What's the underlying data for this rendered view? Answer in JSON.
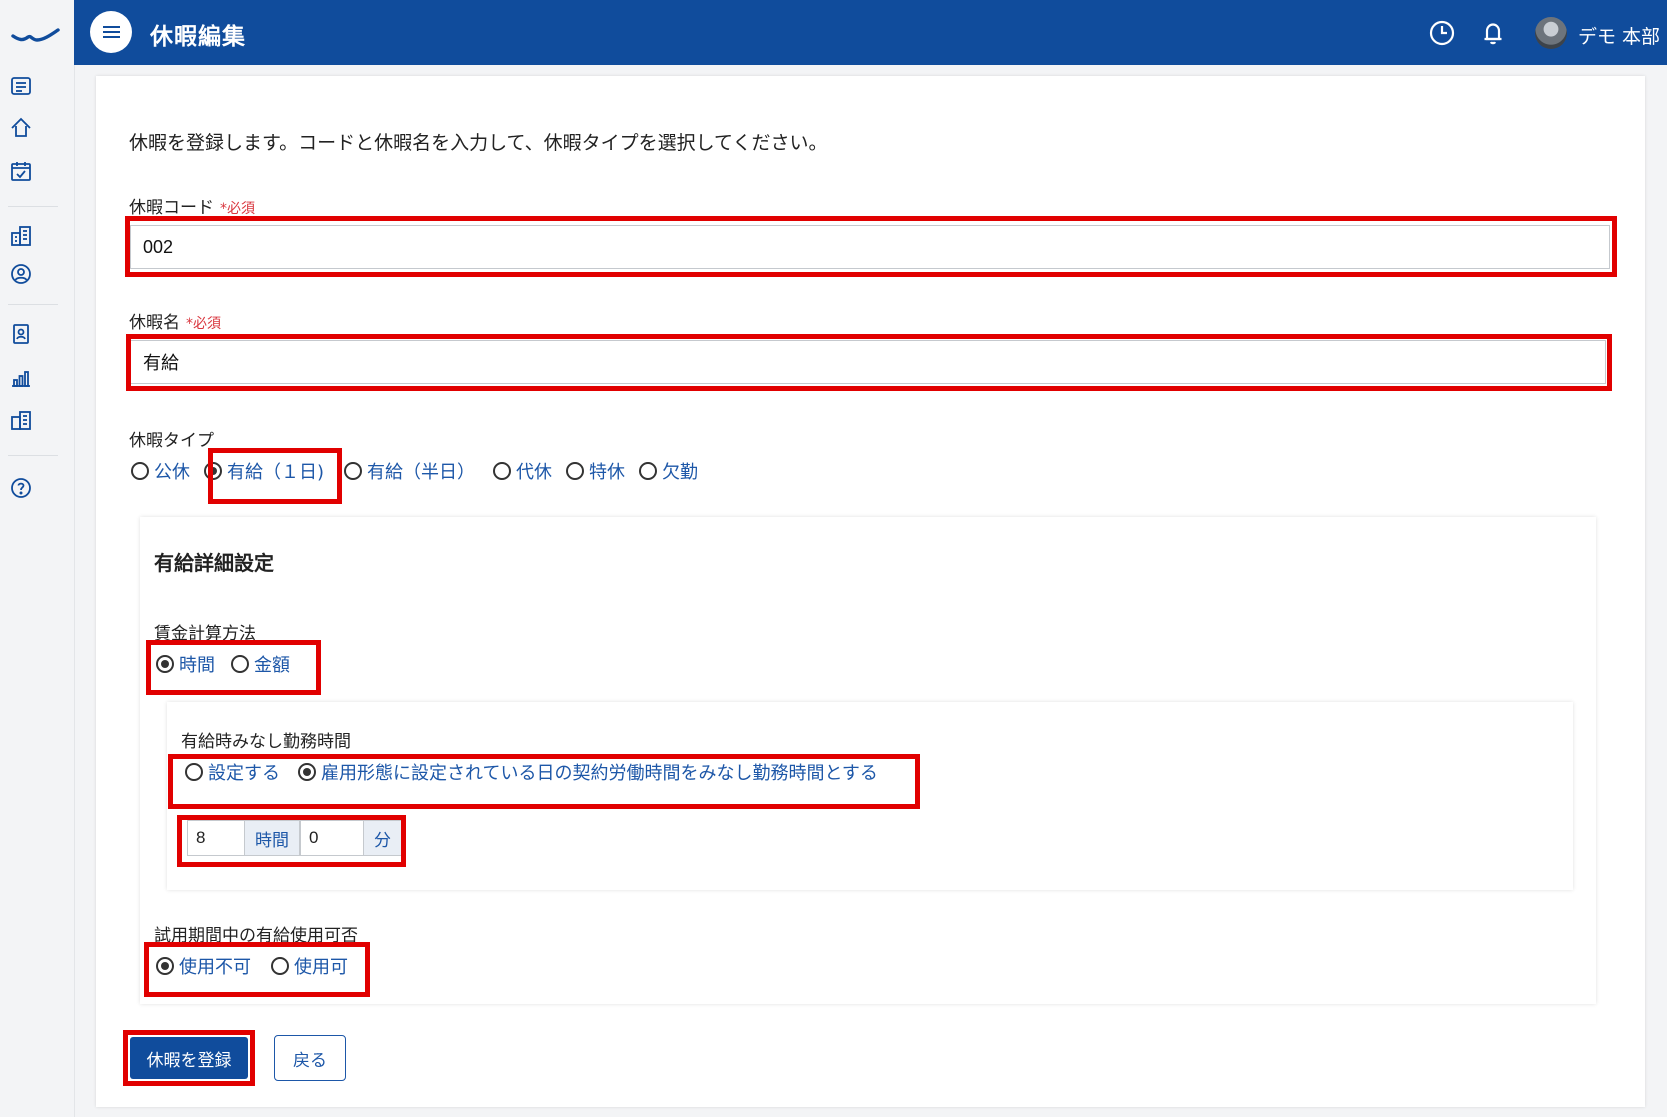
{
  "header": {
    "title": "休暇編集",
    "user_name": "デモ 本部"
  },
  "sidebar": {
    "icons": [
      "list-icon",
      "home-icon",
      "calendar-check-icon",
      "building-icon",
      "user-circle-icon",
      "id-badge-icon",
      "bar-chart-icon",
      "office-icon",
      "help-icon"
    ]
  },
  "form": {
    "intro": "休暇を登録します。コードと休暇名を入力して、休暇タイプを選択してください。",
    "required_mark": "*必須",
    "code_label": "休暇コード",
    "code_value": "002",
    "name_label": "休暇名",
    "name_value": "有給",
    "type_label": "休暇タイプ",
    "type_options": [
      "公休",
      "有給（１日)",
      "有給（半日）",
      "代休",
      "特休",
      "欠勤"
    ],
    "type_selected": "有給（１日)"
  },
  "detail": {
    "title": "有給詳細設定",
    "wage_label": "賃金計算方法",
    "wage_options": [
      "時間",
      "金額"
    ],
    "wage_selected": "時間",
    "deemed_label": "有給時みなし勤務時間",
    "deemed_options": [
      "設定する",
      "雇用形態に設定されている日の契約労働時間をみなし勤務時間とする"
    ],
    "deemed_selected": "雇用形態に設定されている日の契約労働時間をみなし勤務時間とする",
    "hours_value": "8",
    "hours_unit": "時間",
    "minutes_value": "0",
    "minutes_unit": "分",
    "trial_label": "試用期間中の有給使用可否",
    "trial_options": [
      "使用不可",
      "使用可"
    ],
    "trial_selected": "使用不可"
  },
  "actions": {
    "submit_label": "休暇を登録",
    "back_label": "戻る"
  },
  "colors": {
    "header_bg": "#104c9c",
    "link_blue": "#1d57a8",
    "highlight_red": "#e10000",
    "required_red": "#d9363e"
  }
}
